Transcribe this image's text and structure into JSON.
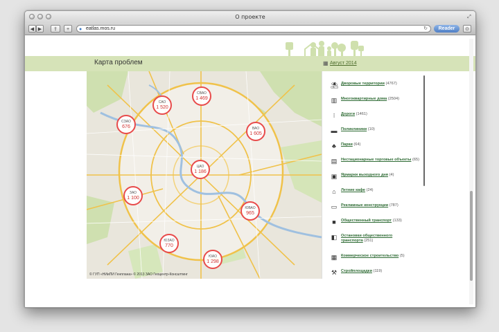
{
  "window": {
    "title": "О проекте"
  },
  "toolbar": {
    "url": "eatlas.mos.ru",
    "reader_label": "Reader"
  },
  "page": {
    "title": "Карта проблем",
    "date_link": "Август 2014"
  },
  "map": {
    "copyright": "© ГУП «НИиПИ Генплана» © 2013 ЗАО Геоцентр-Консалтинг",
    "districts": [
      {
        "name": "САО",
        "value": "1 520"
      },
      {
        "name": "СВАО",
        "value": "1 469"
      },
      {
        "name": "СЗАО",
        "value": "676"
      },
      {
        "name": "ВАО",
        "value": "1 605"
      },
      {
        "name": "ЦАО",
        "value": "1 186"
      },
      {
        "name": "ЗАО",
        "value": "1 100"
      },
      {
        "name": "ЮВАО",
        "value": "965"
      },
      {
        "name": "ЮЗАО",
        "value": "770"
      },
      {
        "name": "ЮАО",
        "value": "1 298"
      }
    ]
  },
  "categories": [
    {
      "icon": "yard-icon",
      "label": "Дворовые территории",
      "count": "(4767)"
    },
    {
      "icon": "apartment-icon",
      "label": "Многоквартирные дома",
      "count": "(2504)"
    },
    {
      "icon": "traffic-light-icon",
      "label": "Дороги",
      "count": "(1461)"
    },
    {
      "icon": "clinic-icon",
      "label": "Поликлиники",
      "count": "(10)"
    },
    {
      "icon": "trees-icon",
      "label": "Парки",
      "count": "(64)"
    },
    {
      "icon": "kiosk-icon",
      "label": "Нестационарные торговые объекты",
      "count": "(65)"
    },
    {
      "icon": "fair-icon",
      "label": "Ярмарки выходного дня",
      "count": "(4)"
    },
    {
      "icon": "cafe-icon",
      "label": "Летние кафе",
      "count": "(24)"
    },
    {
      "icon": "billboard-icon",
      "label": "Рекламные конструкции",
      "count": "(787)"
    },
    {
      "icon": "bus-icon",
      "label": "Общественный транспорт",
      "count": "(133)"
    },
    {
      "icon": "bus-stop-icon",
      "label": "Остановки общественного транспорта",
      "count": "(251)"
    },
    {
      "icon": "construction-icon",
      "label": "Коммерческое строительство",
      "count": "(5)"
    },
    {
      "icon": "crane-icon",
      "label": "Стройплощадки",
      "count": "(119)"
    }
  ]
}
